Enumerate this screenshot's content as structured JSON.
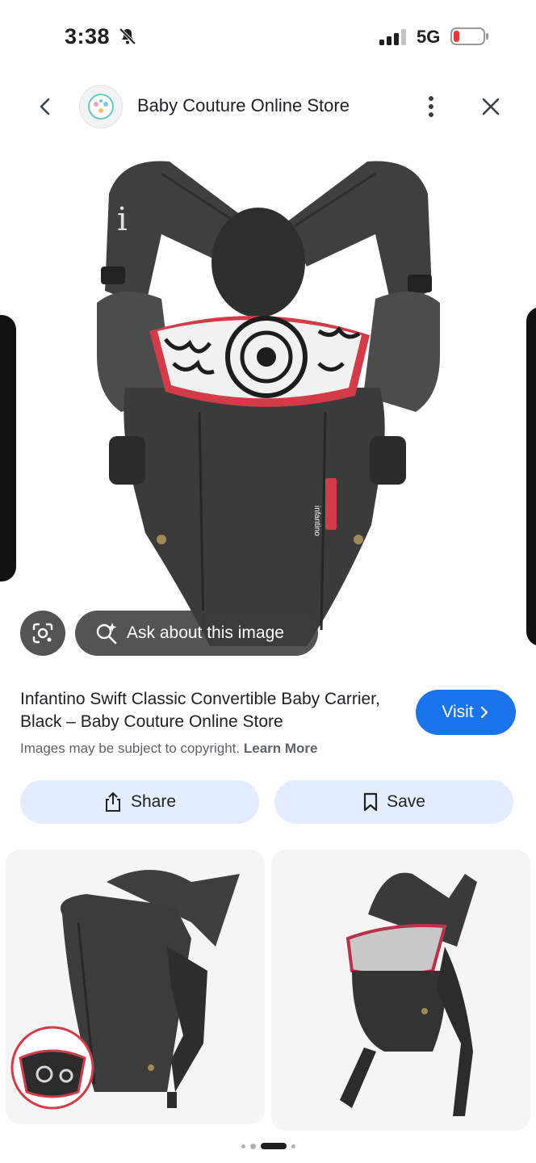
{
  "status_bar": {
    "time": "3:38",
    "network": "5G",
    "icons": [
      "bell-slash-icon",
      "signal-icon",
      "battery-low-icon"
    ]
  },
  "header": {
    "store_name": "Baby Couture Online Store",
    "icons": [
      "back-chevron-icon",
      "more-vert-icon",
      "close-icon"
    ]
  },
  "hero": {
    "ask_label": "Ask about this image",
    "brand_tag": "infantino",
    "icons": [
      "lens-icon",
      "sparkle-search-icon"
    ]
  },
  "product": {
    "title": "Infantino Swift Classic Convertible Baby Carrier, Black – Baby Couture Online Store",
    "copyright_text": "Images may be subject to copyright.",
    "learn_more": "Learn More",
    "visit_label": "Visit"
  },
  "actions": {
    "share_label": "Share",
    "save_label": "Save"
  },
  "colors": {
    "accent": "#1a73e8",
    "action_bg": "#e3edfd",
    "carrier": "#3b3b3b",
    "trim_red": "#d23b47"
  },
  "pager": {
    "active_index": 2,
    "count": 4
  }
}
